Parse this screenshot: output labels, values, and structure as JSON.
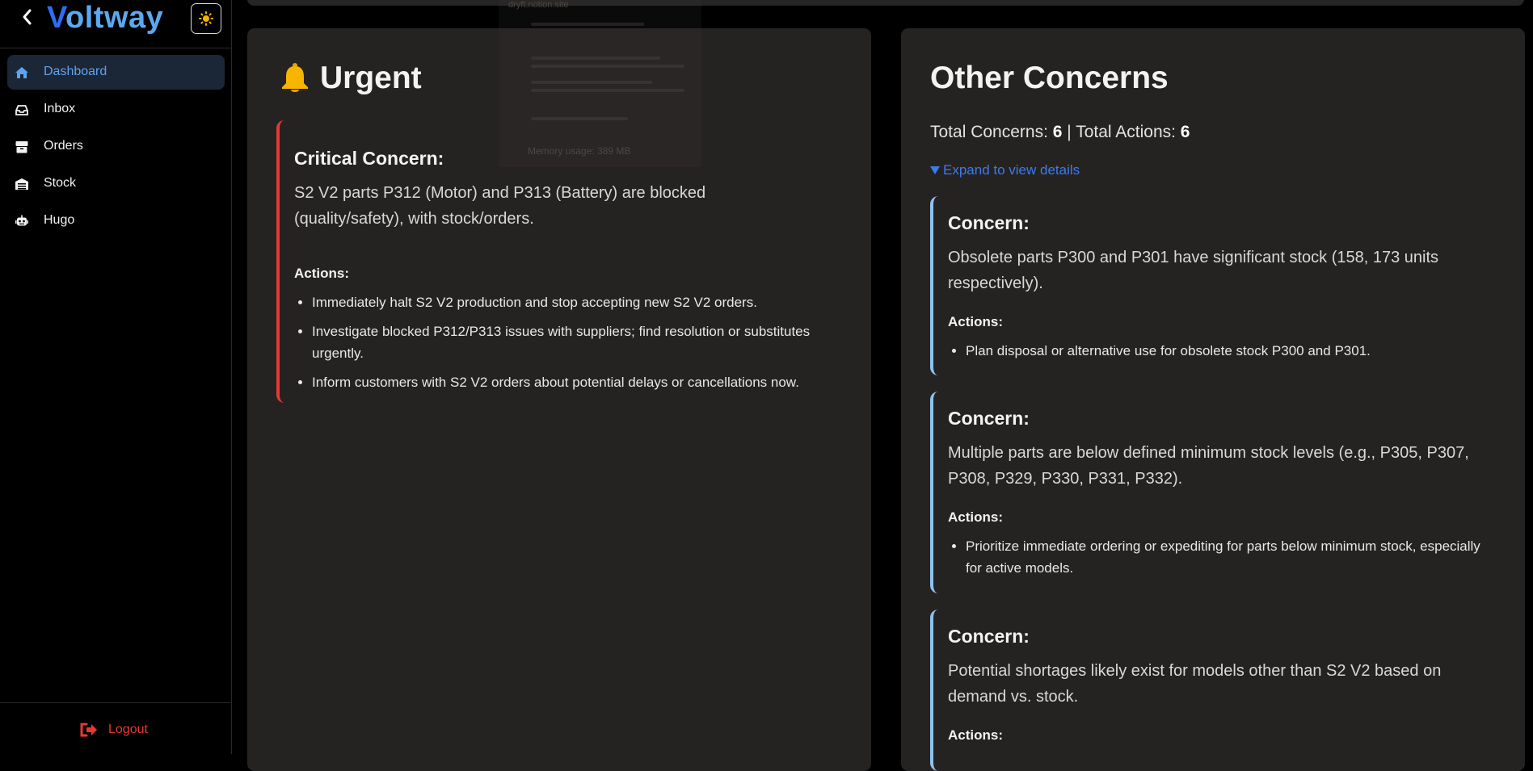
{
  "sidebar": {
    "back_icon": "chevron-left-icon",
    "logo_first": "V",
    "logo_rest": "oltway",
    "theme_icon": "sun-icon",
    "items": [
      {
        "label": "Dashboard",
        "icon": "home-icon",
        "active": true
      },
      {
        "label": "Inbox",
        "icon": "inbox-icon",
        "active": false
      },
      {
        "label": "Orders",
        "icon": "box-icon",
        "active": false
      },
      {
        "label": "Stock",
        "icon": "warehouse-icon",
        "active": false
      },
      {
        "label": "Hugo",
        "icon": "robot-icon",
        "active": false
      }
    ],
    "logout_label": "Logout"
  },
  "colors": {
    "accent": "#5ea3ef",
    "logo_blue": "#2e6df6",
    "critical": "#e53935",
    "concern_border": "#8ec1ec",
    "link": "#3b7bf0",
    "panel_bg": "#252322"
  },
  "ghost_overlay": {
    "title": "dryft.notion.site",
    "memory": "Memory usage: 389 MB"
  },
  "urgent": {
    "title": "Urgent",
    "icon": "bell-icon",
    "critical": {
      "heading": "Critical Concern:",
      "description": "S2 V2 parts P312 (Motor) and P313 (Battery) are blocked (quality/safety), with stock/orders.",
      "actions_label": "Actions:",
      "actions": [
        "Immediately halt S2 V2 production and stop accepting new S2 V2 orders.",
        "Investigate blocked P312/P313 issues with suppliers; find resolution or substitutes urgently.",
        "Inform customers with S2 V2 orders about potential delays or cancellations now."
      ]
    }
  },
  "other": {
    "title": "Other Concerns",
    "total_concerns_label": "Total Concerns:",
    "total_concerns": "6",
    "separator": "|",
    "total_actions_label": "Total Actions:",
    "total_actions": "6",
    "expand_label": "Expand to view details",
    "concerns": [
      {
        "heading": "Concern:",
        "description": "Obsolete parts P300 and P301 have significant stock (158, 173 units respectively).",
        "actions_label": "Actions:",
        "actions": [
          "Plan disposal or alternative use for obsolete stock P300 and P301."
        ]
      },
      {
        "heading": "Concern:",
        "description": "Multiple parts are below defined minimum stock levels (e.g., P305, P307, P308, P329, P330, P331, P332).",
        "actions_label": "Actions:",
        "actions": [
          "Prioritize immediate ordering or expediting for parts below minimum stock, especially for active models."
        ]
      },
      {
        "heading": "Concern:",
        "description": "Potential shortages likely exist for models other than S2 V2 based on demand vs. stock.",
        "actions_label": "Actions:",
        "actions": []
      }
    ]
  }
}
